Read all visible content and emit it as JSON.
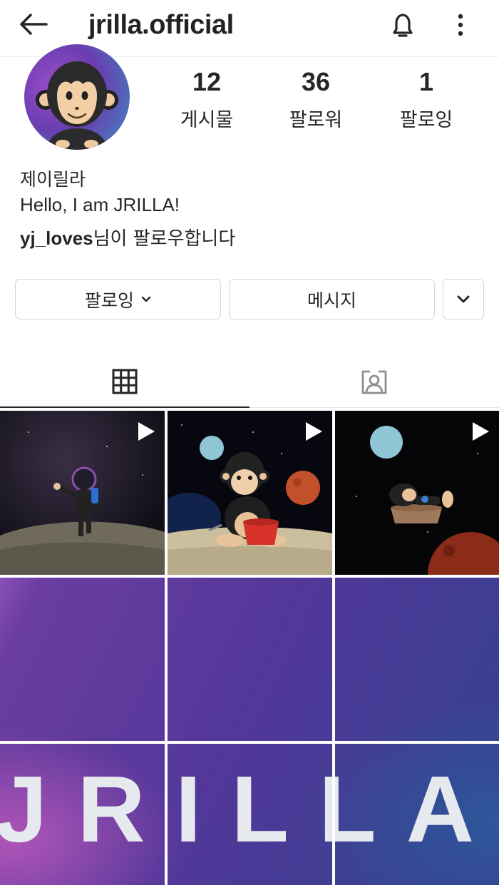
{
  "header": {
    "username": "jrilla.official",
    "back_icon": "arrow-left-icon",
    "bell_icon": "bell-icon",
    "more_icon": "more-vertical-icon"
  },
  "profile": {
    "stats": [
      {
        "value": "12",
        "label": "게시물"
      },
      {
        "value": "36",
        "label": "팔로워"
      },
      {
        "value": "1",
        "label": "팔로잉"
      }
    ],
    "display_name": "제이릴라",
    "bio": "Hello, I am JRILLA!",
    "followed_by_user": "yj_loves",
    "followed_by_suffix": "님이 팔로우합니다"
  },
  "actions": {
    "following_label": "팔로잉",
    "message_label": "메시지"
  },
  "tabs": [
    {
      "name": "grid",
      "icon": "grid-icon",
      "active": true
    },
    {
      "name": "tagged",
      "icon": "tagged-person-icon",
      "active": false
    }
  ],
  "posts": {
    "banner_text": "JRILLA",
    "video_posts": 3,
    "accent_purple": "#5b3aa0",
    "accent_blue": "#2f7fb8"
  }
}
